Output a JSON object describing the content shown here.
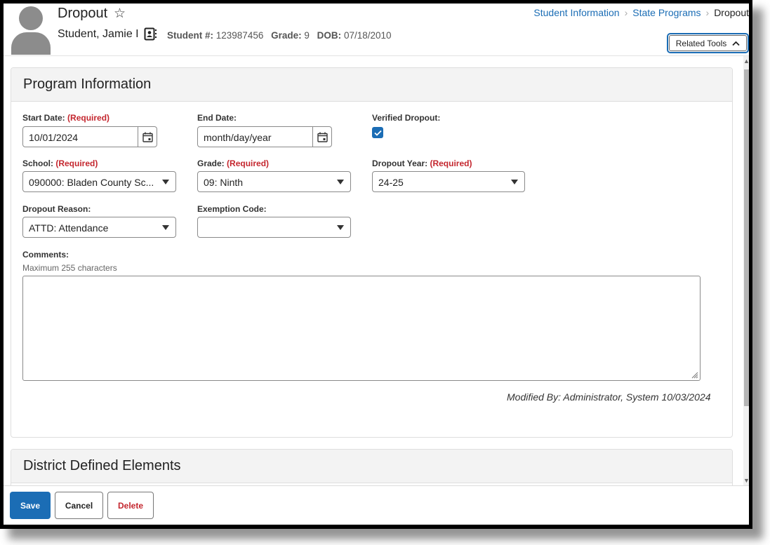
{
  "header": {
    "page_title": "Dropout",
    "student_name": "Student, Jamie I",
    "student_number_label": "Student #:",
    "student_number": "123987456",
    "grade_label": "Grade:",
    "grade": "9",
    "dob_label": "DOB:",
    "dob": "07/18/2010",
    "favorite_icon": "star-outline-icon",
    "id_card_icon": "contact-card-icon"
  },
  "breadcrumb": {
    "items": [
      "Student Information",
      "State Programs"
    ],
    "current": "Dropout",
    "separator": ">"
  },
  "related_tools": {
    "label": "Related Tools",
    "icon": "chevron-up-icon"
  },
  "program_info": {
    "title": "Program Information",
    "required_text": "(Required)",
    "start_date": {
      "label": "Start Date:",
      "value": "10/01/2024"
    },
    "end_date": {
      "label": "End Date:",
      "placeholder": "month/day/year"
    },
    "verified_dropout": {
      "label": "Verified Dropout:",
      "checked": true
    },
    "school": {
      "label": "School:",
      "value": "090000: Bladen County Sc..."
    },
    "grade": {
      "label": "Grade:",
      "value": "09: Ninth"
    },
    "dropout_year": {
      "label": "Dropout Year:",
      "value": "24-25"
    },
    "dropout_reason": {
      "label": "Dropout Reason:",
      "value": "ATTD: Attendance"
    },
    "exemption_code": {
      "label": "Exemption Code:",
      "value": ""
    },
    "comments": {
      "label": "Comments:",
      "hint": "Maximum 255 characters",
      "value": ""
    },
    "modified_by": "Modified By: Administrator, System 10/03/2024"
  },
  "district_defined": {
    "title": "District Defined Elements"
  },
  "footer": {
    "save_label": "Save",
    "cancel_label": "Cancel",
    "delete_label": "Delete"
  },
  "colors": {
    "primary": "#1b6db5",
    "required": "#c4262e",
    "card_header": "#f3f3f3"
  }
}
